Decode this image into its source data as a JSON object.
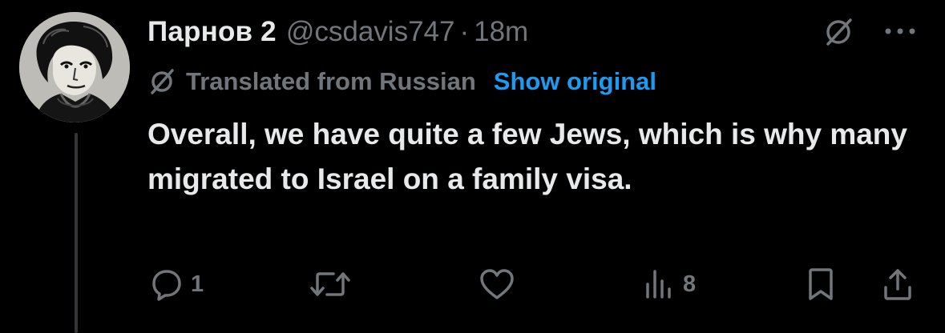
{
  "tweet": {
    "display_name": "Парнов 2",
    "handle": "@csdavis747",
    "separator": "·",
    "time": "18m",
    "translation_note": "Translated from Russian",
    "show_original_label": "Show original",
    "text": "Overall, we have quite a few Jews, which is why many migrated to Israel on a family visa."
  },
  "actions": {
    "reply_count": "1",
    "repost_count": "",
    "like_count": "",
    "views_count": "8"
  },
  "icons": {
    "avatar": "avatar-portrait",
    "grok": "grok-icon",
    "more": "more-icon",
    "translate": "translate-icon",
    "reply": "reply-icon",
    "repost": "repost-icon",
    "like": "like-icon",
    "views": "views-icon",
    "bookmark": "bookmark-icon",
    "share": "share-icon"
  },
  "colors": {
    "background": "#000000",
    "primary_text": "#e7e9ea",
    "secondary_text": "#71767b",
    "link": "#1d9bf0",
    "thread_line": "#333639"
  }
}
